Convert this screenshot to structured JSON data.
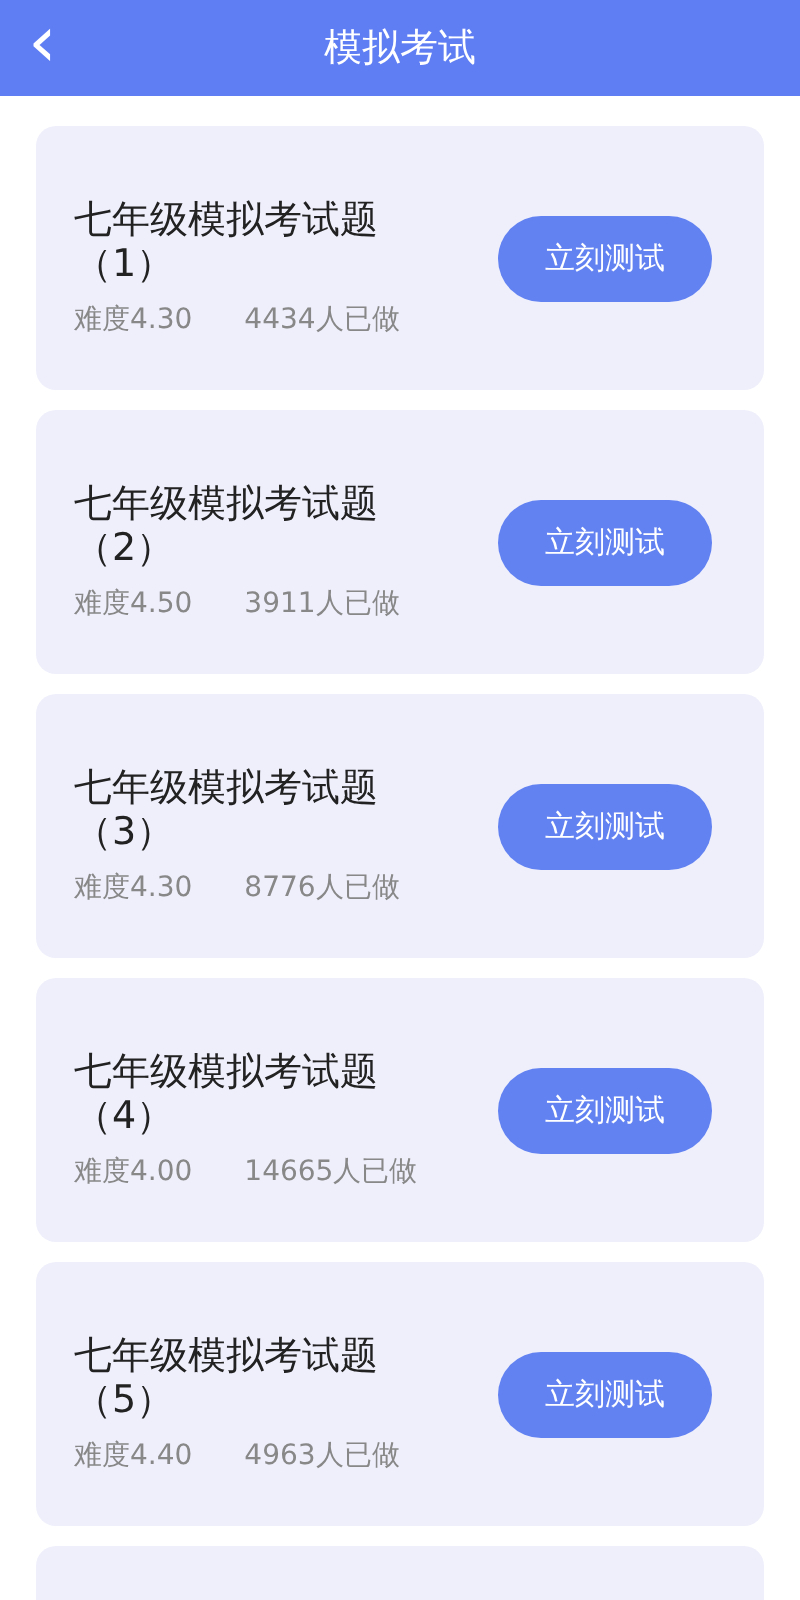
{
  "header": {
    "back_icon": "‹",
    "title": "模拟考试"
  },
  "exams": [
    {
      "title": "七年级模拟考试题（1）",
      "difficulty": "难度4.30",
      "done_count": "4434人已做",
      "button": "立刻测试"
    },
    {
      "title": "七年级模拟考试题（2）",
      "difficulty": "难度4.50",
      "done_count": "3911人已做",
      "button": "立刻测试"
    },
    {
      "title": "七年级模拟考试题（3）",
      "difficulty": "难度4.30",
      "done_count": "8776人已做",
      "button": "立刻测试"
    },
    {
      "title": "七年级模拟考试题（4）",
      "difficulty": "难度4.00",
      "done_count": "14665人已做",
      "button": "立刻测试"
    },
    {
      "title": "七年级模拟考试题（5）",
      "difficulty": "难度4.40",
      "done_count": "4963人已做",
      "button": "立刻测试"
    }
  ]
}
